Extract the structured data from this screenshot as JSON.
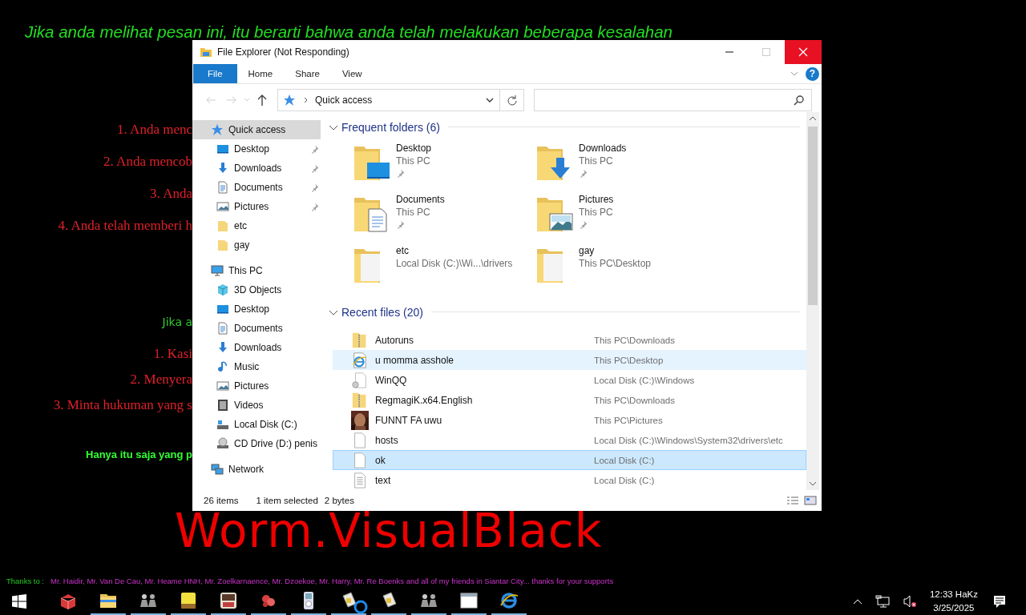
{
  "desktop": {
    "headline": "Jika anda melihat pesan ini, itu berarti bahwa anda telah melakukan beberapa kesalahan",
    "mistakes": [
      "1. Anda menc",
      "2. Anda mencob",
      "3. Anda",
      "4. Anda telah memberi h"
    ],
    "advice": {
      "intro": "Jika a",
      "lines": [
        "1. Kasi",
        "2. Menyera",
        "3. Minta hukuman yang s"
      ],
      "closing": "Hanya itu saja yang p"
    },
    "banner": "Worm.VisualBlack",
    "credits": {
      "label": "Thanks to :",
      "text": "Mr. Haidir, Mr. Van De Cau, Mr. Heame HNH, Mr. Zoelkarnaence, Mr. Dzoekoe, Mr. Harry, Mr. Re Boenks and all of my friends in Siantar City... thanks for your supports"
    }
  },
  "window": {
    "title": "File Explorer (Not Responding)",
    "ribbon_tabs": [
      {
        "label": "File",
        "kind": "menu"
      },
      {
        "label": "Home",
        "kind": "tab"
      },
      {
        "label": "Share",
        "kind": "tab"
      },
      {
        "label": "View",
        "kind": "tab"
      }
    ],
    "help_button": "?",
    "address": {
      "path": "Quick access"
    },
    "nav": [
      {
        "label": "Quick access",
        "kind": "star",
        "selected": true,
        "children": [
          {
            "label": "Desktop",
            "kind": "desktop",
            "pinned": true,
            "selected": false
          },
          {
            "label": "Downloads",
            "kind": "downloads",
            "pinned": true,
            "selected": false
          },
          {
            "label": "Documents",
            "kind": "documents",
            "pinned": true,
            "selected": false
          },
          {
            "label": "Pictures",
            "kind": "pictures",
            "pinned": true,
            "selected": false
          },
          {
            "label": "etc",
            "kind": "folder",
            "pinned": false,
            "selected": false
          },
          {
            "label": "gay",
            "kind": "folder",
            "pinned": false,
            "selected": false
          }
        ]
      },
      {
        "label": "This PC",
        "kind": "pc",
        "selected": false,
        "children": [
          {
            "label": "3D Objects",
            "kind": "cube",
            "selected": false
          },
          {
            "label": "Desktop",
            "kind": "desktop",
            "selected": false
          },
          {
            "label": "Documents",
            "kind": "documents",
            "selected": false
          },
          {
            "label": "Downloads",
            "kind": "downloads",
            "selected": false
          },
          {
            "label": "Music",
            "kind": "music",
            "selected": false
          },
          {
            "label": "Pictures",
            "kind": "pictures",
            "selected": false
          },
          {
            "label": "Videos",
            "kind": "videos",
            "selected": false
          },
          {
            "label": "Local Disk (C:)",
            "kind": "disk",
            "selected": false
          },
          {
            "label": "CD Drive (D:) penis",
            "kind": "cd",
            "selected": false
          }
        ]
      },
      {
        "label": "Network",
        "kind": "network",
        "selected": false
      }
    ],
    "frequent_folders": {
      "heading": "Frequent folders (6)",
      "expanded": true,
      "items": [
        {
          "name": "Desktop",
          "location": "This PC",
          "kind": "desktop",
          "pinned": true
        },
        {
          "name": "Downloads",
          "location": "This PC",
          "kind": "downloads",
          "pinned": true
        },
        {
          "name": "Documents",
          "location": "This PC",
          "kind": "documents",
          "pinned": true
        },
        {
          "name": "Pictures",
          "location": "This PC",
          "kind": "pictures",
          "pinned": true
        },
        {
          "name": "etc",
          "location": "Local Disk (C:)\\Wi...\\drivers",
          "kind": "plain",
          "pinned": false
        },
        {
          "name": "gay",
          "location": "This PC\\Desktop",
          "kind": "plain",
          "pinned": false
        }
      ]
    },
    "recent_files": {
      "heading": "Recent files (20)",
      "expanded": true,
      "items": [
        {
          "name": "Autoruns",
          "location": "This PC\\Downloads",
          "kind": "zip",
          "hovered": false,
          "selected": false
        },
        {
          "name": "u momma asshole",
          "location": "This PC\\Desktop",
          "kind": "web",
          "hovered": true,
          "selected": false
        },
        {
          "name": "WinQQ",
          "location": "Local Disk (C:)\\Windows",
          "kind": "app",
          "hovered": false,
          "selected": false
        },
        {
          "name": "RegmagiK.x64.English",
          "location": "This PC\\Downloads",
          "kind": "zip",
          "hovered": false,
          "selected": false
        },
        {
          "name": "FUNNT FA uwu",
          "location": "This PC\\Pictures",
          "hovered": false,
          "selected": false
        },
        {
          "name": "hosts",
          "location": "Local Disk (C:)\\Windows\\System32\\drivers\\etc",
          "kind": "file",
          "hovered": false,
          "selected": false
        },
        {
          "name": "ok",
          "location": "Local Disk (C:)",
          "kind": "file",
          "hovered": false,
          "selected": true
        },
        {
          "name": "text",
          "location": "Local Disk (C:)",
          "kind": "text",
          "hovered": false,
          "selected": false
        }
      ]
    },
    "status_bar": {
      "item_count": "26 items",
      "selection": "1 item selected",
      "size": "2 bytes"
    }
  },
  "taskbar": {
    "apps": [
      {
        "kind": "box",
        "running": false
      },
      {
        "kind": "folder",
        "running": true
      },
      {
        "kind": "figures",
        "running": true
      },
      {
        "kind": "tile",
        "running": true
      },
      {
        "kind": "tile2",
        "running": true
      },
      {
        "kind": "blob",
        "running": true
      },
      {
        "kind": "player",
        "running": true
      },
      {
        "kind": "document",
        "running": true
      },
      {
        "kind": "document",
        "running": true
      },
      {
        "kind": "figures",
        "running": true
      },
      {
        "kind": "window",
        "running": true
      },
      {
        "kind": "browser",
        "running": true
      }
    ],
    "clock": {
      "time": "12:33 HaKz",
      "date": "3/25/2025"
    }
  }
}
